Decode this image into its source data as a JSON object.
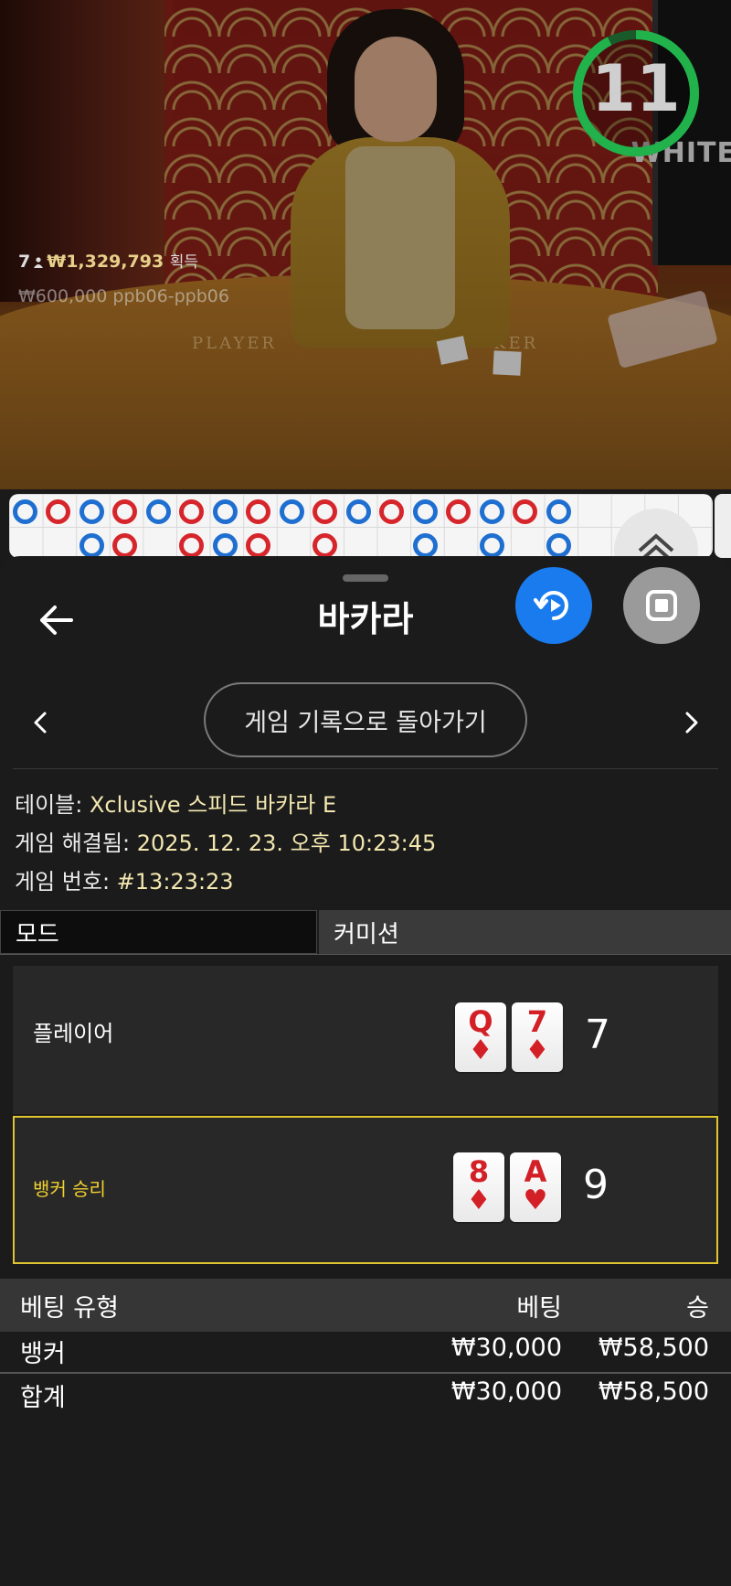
{
  "video": {
    "timer": "11",
    "monitor_text": "WHITE",
    "felt_player": "PLAYER",
    "felt_banker": "KER",
    "players_count": "7",
    "players_amount": "₩1,329,793",
    "players_gain_label": "획득",
    "bet_line": "₩600,000 ppb06-ppb06"
  },
  "header": {
    "title": "바카라",
    "history_button": "게임 기록으로 돌아가기"
  },
  "info": {
    "table_label": "테이블: ",
    "table_value": "Xclusive 스피드 바카라 E",
    "resolved_label": "게임 해결됨: ",
    "resolved_value": "2025. 12. 23. 오후 10:23:45",
    "number_label": "게임 번호: ",
    "number_value": "#13:23:23"
  },
  "tabs": {
    "mode": "모드",
    "commission": "커미션"
  },
  "result": {
    "player": {
      "label": "플레이어",
      "cards": [
        {
          "rank": "Q",
          "suit": "♦"
        },
        {
          "rank": "7",
          "suit": "♦"
        }
      ],
      "score": "7"
    },
    "banker": {
      "label": "뱅커 승리",
      "cards": [
        {
          "rank": "8",
          "suit": "♦"
        },
        {
          "rank": "A",
          "suit": "♥"
        }
      ],
      "score": "9"
    }
  },
  "bets": {
    "headers": {
      "type": "베팅 유형",
      "bet": "베팅",
      "win": "승"
    },
    "rows": [
      {
        "type": "뱅커",
        "bet": "₩30,000",
        "win": "₩58,500"
      }
    ],
    "total": {
      "type": "합계",
      "bet": "₩30,000",
      "win": "₩58,500"
    }
  },
  "colors": {
    "accent_blue": "#1a7bef",
    "win_border": "#e0c531",
    "banker_label": "#f2d12e",
    "card_red": "#d32027",
    "timer_green": "#22b24c"
  },
  "icons": {
    "back": "arrow-left-icon",
    "replay": "replay-icon",
    "stop": "stop-icon",
    "prev": "chevron-left-icon",
    "next": "chevron-right-icon",
    "roadmap_toggle": "double-chevron-up-icon"
  }
}
